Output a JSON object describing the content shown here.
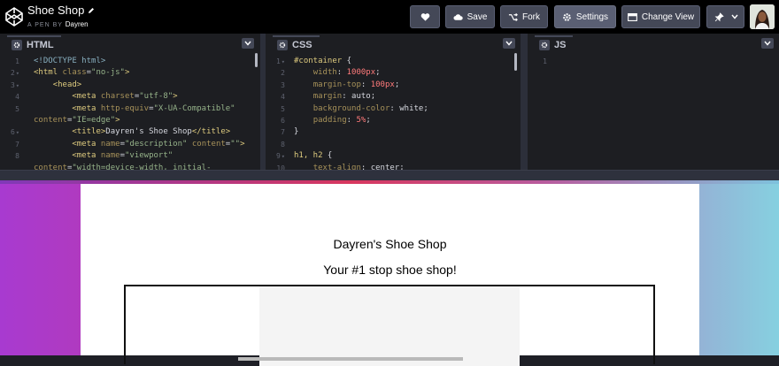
{
  "header": {
    "pen_title": "Shoe Shop",
    "pen_by_label": "A PEN BY",
    "author": "Dayren",
    "buttons": {
      "love": "",
      "save": "Save",
      "fork": "Fork",
      "settings": "Settings",
      "change_view": "Change View"
    }
  },
  "editors": {
    "html": {
      "label": "HTML",
      "lines": [
        {
          "n": "1",
          "fold": "",
          "segments": [
            {
              "t": "doc",
              "v": "<!DOCTYPE html>"
            }
          ]
        },
        {
          "n": "2",
          "fold": "▾",
          "segments": [
            {
              "t": "tag",
              "v": "<html "
            },
            {
              "t": "attr",
              "v": "class"
            },
            {
              "t": "plain",
              "v": "="
            },
            {
              "t": "str",
              "v": "\"no-js\""
            },
            {
              "t": "tag",
              "v": ">"
            }
          ]
        },
        {
          "n": "3",
          "fold": "▾",
          "segments": [
            {
              "t": "plain",
              "v": "    "
            },
            {
              "t": "tag",
              "v": "<head>"
            }
          ]
        },
        {
          "n": "4",
          "fold": "",
          "segments": [
            {
              "t": "plain",
              "v": "        "
            },
            {
              "t": "tag",
              "v": "<meta "
            },
            {
              "t": "attr",
              "v": "charset"
            },
            {
              "t": "plain",
              "v": "="
            },
            {
              "t": "str",
              "v": "\"utf-8\""
            },
            {
              "t": "tag",
              "v": ">"
            }
          ]
        },
        {
          "n": "5",
          "fold": "",
          "segments": [
            {
              "t": "plain",
              "v": "        "
            },
            {
              "t": "tag",
              "v": "<meta "
            },
            {
              "t": "attr",
              "v": "http-equiv"
            },
            {
              "t": "plain",
              "v": "="
            },
            {
              "t": "str",
              "v": "\"X-UA-Compatible\""
            }
          ]
        },
        {
          "n": "",
          "fold": "",
          "segments": [
            {
              "t": "attr",
              "v": "content"
            },
            {
              "t": "plain",
              "v": "="
            },
            {
              "t": "str",
              "v": "\"IE=edge\""
            },
            {
              "t": "tag",
              "v": ">"
            }
          ]
        },
        {
          "n": "6",
          "fold": "▾",
          "segments": [
            {
              "t": "plain",
              "v": "        "
            },
            {
              "t": "tag",
              "v": "<title>"
            },
            {
              "t": "plain",
              "v": "Dayren's Shoe Shop"
            },
            {
              "t": "tag",
              "v": "</title>"
            }
          ]
        },
        {
          "n": "7",
          "fold": "",
          "segments": [
            {
              "t": "plain",
              "v": "        "
            },
            {
              "t": "tag",
              "v": "<meta "
            },
            {
              "t": "attr",
              "v": "name"
            },
            {
              "t": "plain",
              "v": "="
            },
            {
              "t": "str",
              "v": "\"description\""
            },
            {
              "t": "plain",
              "v": " "
            },
            {
              "t": "attr",
              "v": "content"
            },
            {
              "t": "plain",
              "v": "="
            },
            {
              "t": "str",
              "v": "\"\""
            },
            {
              "t": "tag",
              "v": ">"
            }
          ]
        },
        {
          "n": "8",
          "fold": "",
          "segments": [
            {
              "t": "plain",
              "v": "        "
            },
            {
              "t": "tag",
              "v": "<meta "
            },
            {
              "t": "attr",
              "v": "name"
            },
            {
              "t": "plain",
              "v": "="
            },
            {
              "t": "str",
              "v": "\"viewport\""
            }
          ]
        },
        {
          "n": "",
          "fold": "",
          "segments": [
            {
              "t": "attr",
              "v": "content"
            },
            {
              "t": "plain",
              "v": "="
            },
            {
              "t": "str",
              "v": "\"width=device-width, initial-"
            }
          ]
        }
      ]
    },
    "css": {
      "label": "CSS",
      "lines": [
        {
          "n": "1",
          "fold": "▾",
          "segments": [
            {
              "t": "sel",
              "v": "#container"
            },
            {
              "t": "plain",
              "v": " {"
            }
          ]
        },
        {
          "n": "2",
          "fold": "",
          "segments": [
            {
              "t": "plain",
              "v": "    "
            },
            {
              "t": "prop",
              "v": "width"
            },
            {
              "t": "plain",
              "v": ": "
            },
            {
              "t": "val",
              "v": "1000px"
            },
            {
              "t": "plain",
              "v": ";"
            }
          ]
        },
        {
          "n": "3",
          "fold": "",
          "segments": [
            {
              "t": "plain",
              "v": "    "
            },
            {
              "t": "prop",
              "v": "margin-top"
            },
            {
              "t": "plain",
              "v": ": "
            },
            {
              "t": "val",
              "v": "100px"
            },
            {
              "t": "plain",
              "v": ";"
            }
          ]
        },
        {
          "n": "4",
          "fold": "",
          "segments": [
            {
              "t": "plain",
              "v": "    "
            },
            {
              "t": "prop",
              "v": "margin"
            },
            {
              "t": "plain",
              "v": ": "
            },
            {
              "t": "plain",
              "v": "auto;"
            }
          ]
        },
        {
          "n": "5",
          "fold": "",
          "segments": [
            {
              "t": "plain",
              "v": "    "
            },
            {
              "t": "prop",
              "v": "background-color"
            },
            {
              "t": "plain",
              "v": ": "
            },
            {
              "t": "plain",
              "v": "white;"
            }
          ]
        },
        {
          "n": "6",
          "fold": "",
          "segments": [
            {
              "t": "plain",
              "v": "    "
            },
            {
              "t": "prop",
              "v": "padding"
            },
            {
              "t": "plain",
              "v": ": "
            },
            {
              "t": "val",
              "v": "5%"
            },
            {
              "t": "plain",
              "v": ";"
            }
          ]
        },
        {
          "n": "7",
          "fold": "",
          "segments": [
            {
              "t": "plain",
              "v": "}"
            }
          ]
        },
        {
          "n": "8",
          "fold": "",
          "segments": [
            {
              "t": "plain",
              "v": ""
            }
          ]
        },
        {
          "n": "9",
          "fold": "▾",
          "segments": [
            {
              "t": "sel",
              "v": "h1, h2"
            },
            {
              "t": "plain",
              "v": " {"
            }
          ]
        },
        {
          "n": "10",
          "fold": "",
          "segments": [
            {
              "t": "plain",
              "v": "    "
            },
            {
              "t": "prop",
              "v": "text-align"
            },
            {
              "t": "plain",
              "v": ": "
            },
            {
              "t": "plain",
              "v": "center;"
            }
          ]
        }
      ]
    },
    "js": {
      "label": "JS",
      "lines": [
        {
          "n": "1",
          "fold": "",
          "segments": [
            {
              "t": "plain",
              "v": ""
            }
          ]
        }
      ]
    }
  },
  "preview": {
    "title": "Dayren's Shoe Shop",
    "subtitle": "Your #1 stop shoe shop!"
  },
  "colors": {
    "header_bg": "#000000",
    "editor_bg": "#1d1e22",
    "button_bg": "#444857",
    "gradient_left": "#a83ad0",
    "gradient_right": "#86d0e0"
  }
}
